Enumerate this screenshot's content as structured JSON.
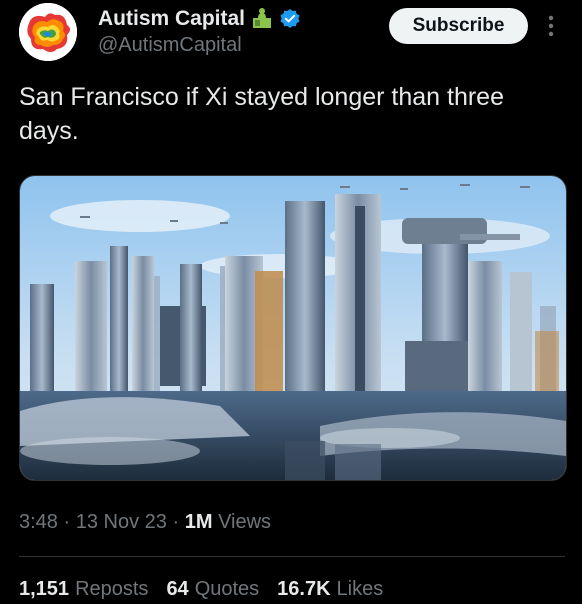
{
  "author": {
    "name": "Autism Capital",
    "handle": "@AutismCapital",
    "badge_icon": "puzzle-piece-icon",
    "verified_icon": "verified-badge-icon",
    "verified_color": "#1d9bf0"
  },
  "subscribe_label": "Subscribe",
  "tweet_text": "San Francisco if Xi stayed longer than three days.",
  "media": {
    "description_icon": "futuristic-city-image"
  },
  "meta": {
    "time": "3:48",
    "sep1": "·",
    "date": "13 Nov 23",
    "sep2": "·",
    "views_count": "1M",
    "views_label": "Views"
  },
  "stats": {
    "reposts_count": "1,151",
    "reposts_label": "Reposts",
    "quotes_count": "64",
    "quotes_label": "Quotes",
    "likes_count": "16.7K",
    "likes_label": "Likes"
  },
  "colors": {
    "background": "#000000",
    "text": "#e7e9ea",
    "secondary": "#71767b",
    "accent": "#1d9bf0"
  }
}
